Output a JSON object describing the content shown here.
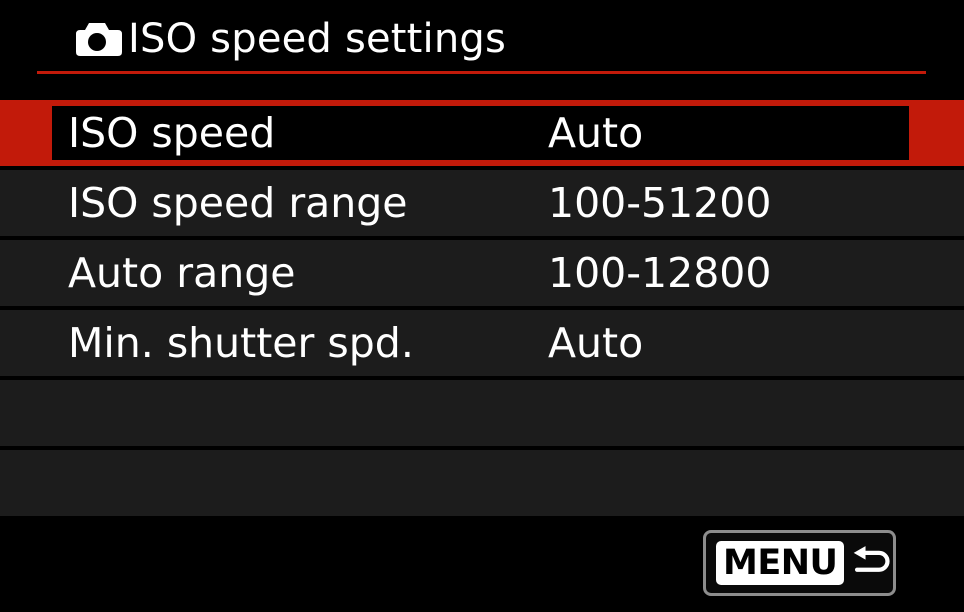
{
  "header": {
    "camera_icon": "camera-icon",
    "title": "ISO speed settings"
  },
  "colors": {
    "accent": "#c21a0a",
    "row_background": "#1c1c1c",
    "background": "#000000"
  },
  "menu": {
    "rows": [
      {
        "label": "ISO speed",
        "value": "Auto",
        "selected": true
      },
      {
        "label": "ISO speed range",
        "value": "100-51200",
        "selected": false
      },
      {
        "label": "Auto range",
        "value": "100-12800",
        "selected": false
      },
      {
        "label": "Min. shutter spd.",
        "value": "Auto",
        "selected": false
      },
      {
        "label": "",
        "value": "",
        "selected": false
      },
      {
        "label": "",
        "value": "",
        "selected": false
      }
    ]
  },
  "footer": {
    "menu_button_label": "MENU",
    "return_icon": "return-arrow-icon"
  }
}
